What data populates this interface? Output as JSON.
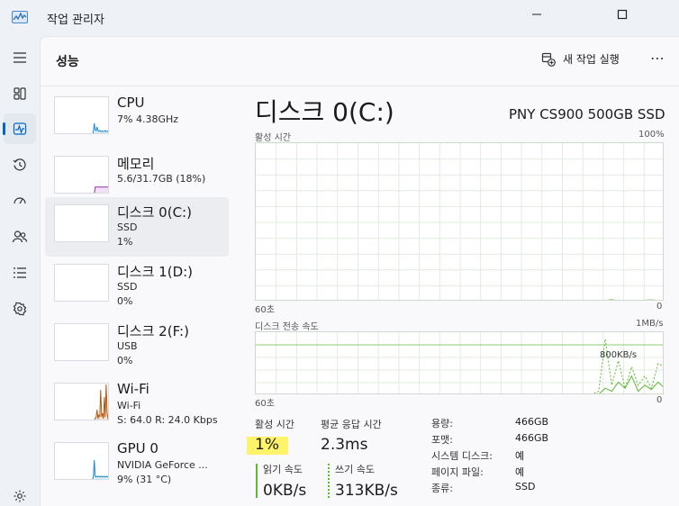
{
  "app": {
    "title": "작업 관리자"
  },
  "colors": {
    "accent": "#0067c0",
    "cpu": "#1b8ad3",
    "memory": "#9a2fae",
    "disk": "#5fb833",
    "wifi": "#b35a12",
    "gpu": "#1b8ad3",
    "highlight": "#fff36a"
  },
  "header": {
    "title": "성능",
    "run_task": "새 작업 실행",
    "more": "⋯"
  },
  "nav": {
    "items": [
      {
        "name": "hamburger-icon"
      },
      {
        "name": "processes-icon"
      },
      {
        "name": "performance-icon",
        "active": true
      },
      {
        "name": "app-history-icon"
      },
      {
        "name": "startup-apps-icon"
      },
      {
        "name": "users-icon"
      },
      {
        "name": "details-icon"
      },
      {
        "name": "services-icon"
      },
      {
        "name": "settings-icon"
      }
    ]
  },
  "devices": [
    {
      "name": "CPU",
      "l1": "7% 4.38GHz",
      "l2": "",
      "color": "#1b8ad3",
      "trace": [
        0,
        0,
        0,
        0,
        0,
        0,
        0,
        0,
        0,
        0,
        0,
        0,
        0,
        0,
        0,
        0,
        0,
        0,
        0,
        0,
        0,
        0,
        0,
        0,
        0,
        0,
        0,
        0,
        0,
        0,
        0,
        0,
        0,
        0,
        0,
        0,
        0,
        0,
        0,
        0,
        0,
        0,
        0.08,
        0.3,
        0.12,
        0.1,
        0.2,
        0.1,
        0.08,
        0.1,
        0.08,
        0.07,
        0.09,
        0.08,
        0.07,
        0.1,
        0.08,
        0.07,
        0.09,
        0.08,
        0.07
      ],
      "active": false
    },
    {
      "name": "메모리",
      "l1": "5.6/31.7GB (18%)",
      "l2": "",
      "color": "#9a2fae",
      "trace": [
        0,
        0,
        0,
        0,
        0,
        0,
        0,
        0,
        0,
        0,
        0,
        0,
        0,
        0,
        0,
        0,
        0,
        0,
        0,
        0,
        0,
        0,
        0,
        0,
        0,
        0,
        0,
        0,
        0,
        0,
        0,
        0,
        0,
        0,
        0,
        0,
        0,
        0,
        0,
        0,
        0,
        0,
        0,
        0,
        0.18,
        0.18,
        0.18,
        0.18,
        0.18,
        0.18,
        0.18,
        0.18,
        0.18,
        0.18,
        0.18,
        0.18,
        0.18,
        0.18,
        0.18,
        0.18,
        0.18
      ],
      "active": false
    },
    {
      "name": "디스크 0(C:)",
      "l1": "SSD",
      "l2": "1%",
      "color": "#5fb833",
      "trace": [],
      "active": true
    },
    {
      "name": "디스크 1(D:)",
      "l1": "SSD",
      "l2": "0%",
      "color": "#5fb833",
      "trace": [],
      "active": false
    },
    {
      "name": "디스크 2(F:)",
      "l1": "USB",
      "l2": "0%",
      "color": "#5fb833",
      "trace": [],
      "active": false
    },
    {
      "name": "Wi-Fi",
      "l1": "Wi-Fi",
      "l2": "S: 64.0  R: 24.0 Kbps",
      "color": "#b35a12",
      "trace": [
        0,
        0,
        0,
        0,
        0,
        0,
        0,
        0,
        0,
        0,
        0,
        0,
        0,
        0,
        0,
        0,
        0,
        0,
        0,
        0,
        0,
        0,
        0,
        0,
        0,
        0,
        0,
        0,
        0,
        0,
        0,
        0,
        0,
        0,
        0,
        0,
        0,
        0,
        0,
        0,
        0,
        0,
        0,
        0,
        0.05,
        0.1,
        0.3,
        0.05,
        0.15,
        0.1,
        0.85,
        0.1,
        0.2,
        0.05,
        0.65,
        0.1,
        1.0,
        0.2,
        0.05,
        0.1,
        0.05
      ],
      "active": false
    },
    {
      "name": "GPU 0",
      "l1": "NVIDIA GeForce ...",
      "l2": "9% (31 °C)",
      "color": "#1b8ad3",
      "trace": [
        0,
        0,
        0,
        0,
        0,
        0,
        0,
        0,
        0,
        0,
        0,
        0,
        0,
        0,
        0,
        0,
        0,
        0,
        0,
        0,
        0,
        0,
        0,
        0,
        0,
        0,
        0,
        0,
        0,
        0,
        0,
        0,
        0,
        0,
        0,
        0,
        0,
        0,
        0,
        0,
        0,
        0,
        0.1,
        0.55,
        0.1,
        0.08,
        0.1,
        0.09,
        0.1,
        0.08,
        0.09,
        0.1,
        0.08,
        0.09,
        0.1,
        0.08,
        0.09,
        0.1,
        0.08,
        0.09,
        0.1
      ],
      "active": false
    }
  ],
  "detail": {
    "title": "디스크 0(C:)",
    "model": "PNY CS900 500GB SSD",
    "active_time": {
      "label": "활성 시간",
      "max": "100%",
      "xlabel": "60초",
      "min": "0",
      "values": [
        0,
        0,
        0,
        0,
        0,
        0,
        0,
        0,
        0,
        0,
        0,
        0,
        0,
        0,
        0,
        0,
        0,
        0,
        0,
        0,
        0,
        0,
        0,
        0,
        0,
        0,
        0,
        0,
        0,
        0,
        0,
        0,
        0,
        0,
        0,
        0,
        0,
        0,
        0,
        0,
        0,
        0,
        0,
        0,
        0,
        0,
        0,
        0,
        0,
        0,
        0,
        0,
        0,
        0.8,
        1.2,
        0.6,
        0.2,
        0,
        0,
        0.9,
        1.1,
        0.8,
        0
      ]
    },
    "transfer": {
      "label": "디스크 전송 속도",
      "max": "1MB/s",
      "xlabel": "60초",
      "min": "0",
      "annotation": "800KB/s",
      "write": [
        0,
        0,
        0,
        0,
        0,
        0,
        0,
        0,
        0,
        0,
        0,
        0,
        0,
        0,
        0,
        0,
        0,
        0,
        0,
        0,
        0,
        0,
        0,
        0,
        0,
        0,
        0,
        0,
        0,
        0,
        0,
        0,
        0,
        0,
        0,
        0,
        0,
        0,
        0,
        0,
        0,
        0,
        0,
        0,
        0,
        0,
        0,
        0,
        0,
        0,
        0,
        0,
        0.05,
        0.9,
        0.15,
        0.55,
        0.1,
        0.45,
        0.15,
        0.3,
        0.1,
        0.5,
        0.45
      ],
      "read": [
        0,
        0,
        0,
        0,
        0,
        0,
        0,
        0,
        0,
        0,
        0,
        0,
        0,
        0,
        0,
        0,
        0,
        0,
        0,
        0,
        0,
        0,
        0,
        0,
        0,
        0,
        0,
        0,
        0,
        0,
        0,
        0,
        0,
        0,
        0,
        0,
        0,
        0,
        0,
        0,
        0,
        0,
        0,
        0,
        0,
        0,
        0,
        0,
        0,
        0,
        0,
        0,
        0,
        0.1,
        0.05,
        0.2,
        0.1,
        0.3,
        0.05,
        0.15,
        0.08,
        0.2,
        0.1
      ]
    },
    "stats": {
      "active_time_label": "활성 시간",
      "active_time_value": "1%",
      "response_label": "평균 응답 시간",
      "response_value": "2.3ms",
      "read_label": "읽기 속도",
      "read_value": "0KB/s",
      "write_label": "쓰기 속도",
      "write_value": "313KB/s"
    },
    "properties": [
      {
        "key": "용량:",
        "value": "466GB"
      },
      {
        "key": "포맷:",
        "value": "466GB"
      },
      {
        "key": "시스템 디스크:",
        "value": "예"
      },
      {
        "key": "페이지 파일:",
        "value": "예"
      },
      {
        "key": "종류:",
        "value": "SSD"
      }
    ]
  }
}
